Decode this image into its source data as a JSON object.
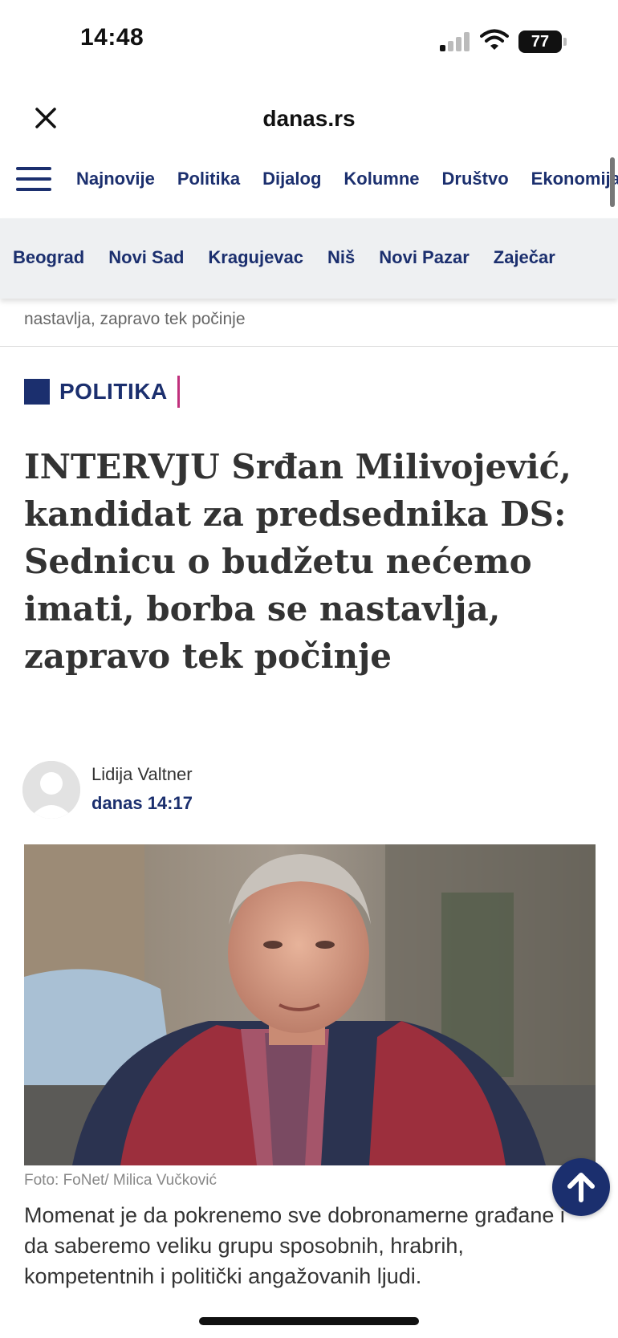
{
  "status_bar": {
    "time": "14:48",
    "battery": "77",
    "icons": [
      "signal-icon",
      "wifi-icon",
      "battery-icon"
    ]
  },
  "browser": {
    "domain": "danas.rs",
    "close_icon": "close-icon"
  },
  "nav": {
    "menu_icon": "hamburger-menu-icon",
    "items": [
      {
        "label": "Najnovije"
      },
      {
        "label": "Politika"
      },
      {
        "label": "Dijalog"
      },
      {
        "label": "Kolumne"
      },
      {
        "label": "Društvo"
      },
      {
        "label": "Ekonomija"
      }
    ]
  },
  "cities": [
    {
      "label": "Beograd"
    },
    {
      "label": "Novi Sad"
    },
    {
      "label": "Kragujevac"
    },
    {
      "label": "Niš"
    },
    {
      "label": "Novi Pazar"
    },
    {
      "label": "Zaječar"
    }
  ],
  "sticky_title": "nastavlja, zapravo tek počinje",
  "article": {
    "category": "POLITIKA",
    "headline": "INTERVJU Srđan Milivojević, kandidat za predsednika DS: Sednicu o budžetu nećemo imati, borba se nastavlja, zapravo tek počinje",
    "author": "Lidija Valtner",
    "date": "danas 14:17",
    "photo_caption": "Foto: FoNet/ Milica Vučković",
    "lead": "Momenat je da pokrenemo sve dobronamerne građane i da saberemo veliku grupu sposobnih, hrabrih, kompetentnih i politički angažovanih ljudi."
  },
  "colors": {
    "brand_navy": "#1b2f6e",
    "category_accent": "#c0307c",
    "city_bar_bg": "#eef0f2"
  }
}
